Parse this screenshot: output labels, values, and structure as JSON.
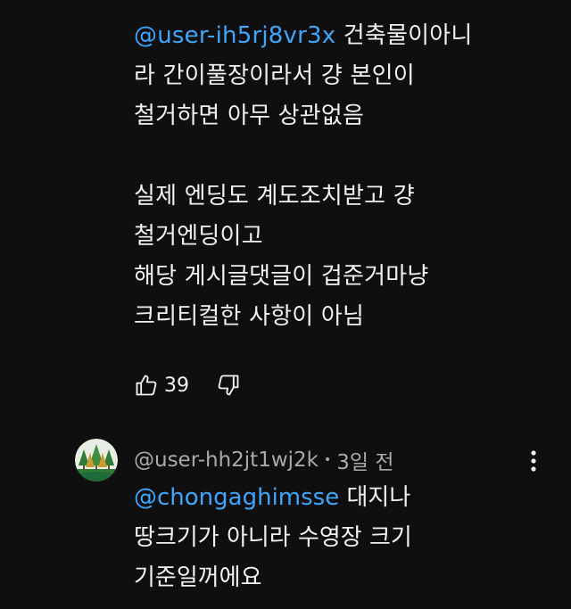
{
  "comment": {
    "mention": "@user-ih5rj8vr3x",
    "line1_rest": " 건축물이아니",
    "line2": "라 간이풀장이라서 걍 본인이",
    "line3": "철거하면 아무 상관없음",
    "line5": "실제 엔딩도 계도조치받고 걍",
    "line6": "철거엔딩이고",
    "line7": "해당 게시글댓글이 겁준거마냥",
    "line8": "크리티컬한 사항이 아님",
    "like_count": "39"
  },
  "reply": {
    "author": "@user-hh2jt1wj2k",
    "separator": "•",
    "time": "3일 전",
    "mention": "@chongaghimsse",
    "line1_rest": " 대지나",
    "line2": "땅크기가 아니라 수영장 크기",
    "line3": "기준일꺼에요"
  },
  "icons": {
    "like": "thumbs-up-icon",
    "dislike": "thumbs-down-icon",
    "more": "more-vert-icon"
  },
  "colors": {
    "background": "#0f0f0f",
    "text": "#f1f1f1",
    "mention": "#3ea6ff",
    "meta": "#aaaaaa"
  }
}
